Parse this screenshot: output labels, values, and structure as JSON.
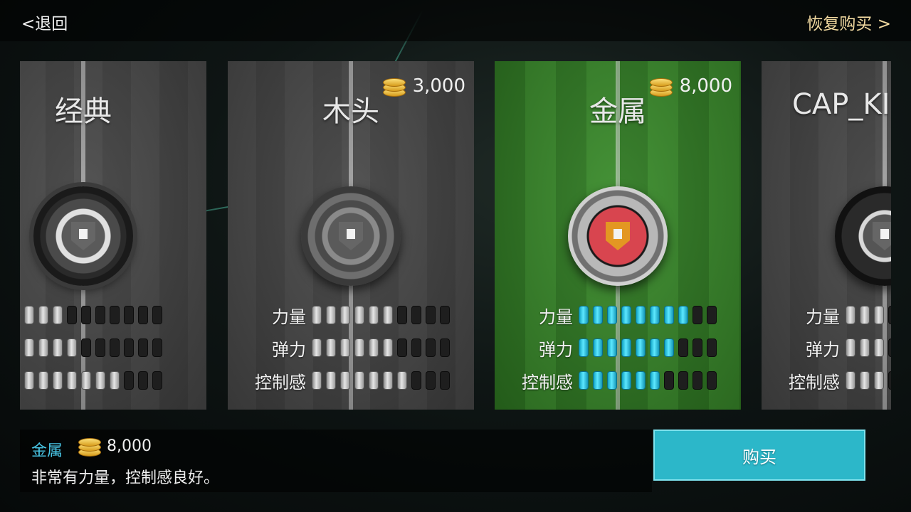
{
  "nav": {
    "back_label": "<退回",
    "restore_label": "恢复购买 >"
  },
  "stat_labels": {
    "power": "力量",
    "bounce": "弹力",
    "control": "控制感"
  },
  "cards": [
    {
      "name": "经典",
      "price": "",
      "theme": "gray",
      "stats": {
        "power": 3,
        "bounce": 4,
        "control": 7
      }
    },
    {
      "name": "木头",
      "price": "3,000",
      "theme": "gray",
      "stats": {
        "power": 6,
        "bounce": 6,
        "control": 7
      }
    },
    {
      "name": "金属",
      "price": "8,000",
      "theme": "green",
      "stats": {
        "power": 8,
        "bounce": 7,
        "control": 6
      }
    },
    {
      "name": "CAP_KI",
      "price": "",
      "theme": "gray",
      "stats": {
        "power": 3,
        "bounce": 3,
        "control": 3
      }
    }
  ],
  "selected": {
    "name": "金属",
    "price": "8,000",
    "description": "非常有力量，控制感良好。"
  },
  "buy_label": "购买",
  "colors": {
    "accent": "#2cb7c9",
    "gold_text": "#f1d9a0",
    "stat_on": "#5de8ff",
    "selected_title": "#49c6e6"
  }
}
